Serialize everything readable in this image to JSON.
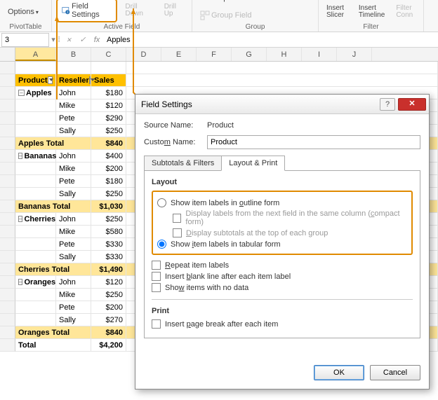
{
  "ribbon": {
    "options": "Options",
    "pivotTable": "PivotTable",
    "fieldSettings": "Field Settings",
    "drillDown": "Drill Down",
    "drillUp": "Drill Up",
    "collapseField": "Collapse Field",
    "activeField": "Active Field",
    "groupField": "Group Field",
    "groupLabel": "Group",
    "insertSlicer": "Insert Slicer",
    "insertTimeline": "Insert Timeline",
    "filterConn": "Filter Conn",
    "filterLabel": "Filter"
  },
  "formula": {
    "namebox": "3",
    "fx": "fx",
    "value": "Apples"
  },
  "cols": [
    "A",
    "B",
    "C",
    "D",
    "E",
    "F",
    "G",
    "H",
    "I",
    "J"
  ],
  "headers": {
    "product": "Product",
    "reseller": "Reseller",
    "sales": "Sales"
  },
  "groups": [
    {
      "name": "Apples",
      "rows": [
        [
          "John",
          "$180"
        ],
        [
          "Mike",
          "$120"
        ],
        [
          "Pete",
          "$290"
        ],
        [
          "Sally",
          "$250"
        ]
      ],
      "totalLabel": "Apples Total",
      "total": "$840"
    },
    {
      "name": "Bananas",
      "rows": [
        [
          "John",
          "$400"
        ],
        [
          "Mike",
          "$200"
        ],
        [
          "Pete",
          "$180"
        ],
        [
          "Sally",
          "$250"
        ]
      ],
      "totalLabel": "Bananas Total",
      "total": "$1,030"
    },
    {
      "name": "Cherries",
      "rows": [
        [
          "John",
          "$250"
        ],
        [
          "Mike",
          "$580"
        ],
        [
          "Pete",
          "$330"
        ],
        [
          "Sally",
          "$330"
        ]
      ],
      "totalLabel": "Cherries Total",
      "total": "$1,490"
    },
    {
      "name": "Oranges",
      "rows": [
        [
          "John",
          "$120"
        ],
        [
          "Mike",
          "$250"
        ],
        [
          "Pete",
          "$200"
        ],
        [
          "Sally",
          "$270"
        ]
      ],
      "totalLabel": "Oranges Total",
      "total": "$840"
    }
  ],
  "grand": {
    "label": "Total",
    "value": "$4,200"
  },
  "dialog": {
    "title": "Field Settings",
    "sourceNameLabel": "Source Name:",
    "sourceName": "Product",
    "customNameLabel": "Custom Name:",
    "customName": "Product",
    "tab1": "Subtotals & Filters",
    "tab2": "Layout & Print",
    "layoutLabel": "Layout",
    "radio1": "Show item labels in outline form",
    "chk1": "Display labels from the next field in the same column (compact form)",
    "chk2": "Display subtotals at the top of each group",
    "radio2": "Show item labels in tabular form",
    "chk3": "Repeat item labels",
    "chk4": "Insert blank line after each item label",
    "chk5": "Show items with no data",
    "printLabel": "Print",
    "chk6": "Insert page break after each item",
    "ok": "OK",
    "cancel": "Cancel"
  }
}
